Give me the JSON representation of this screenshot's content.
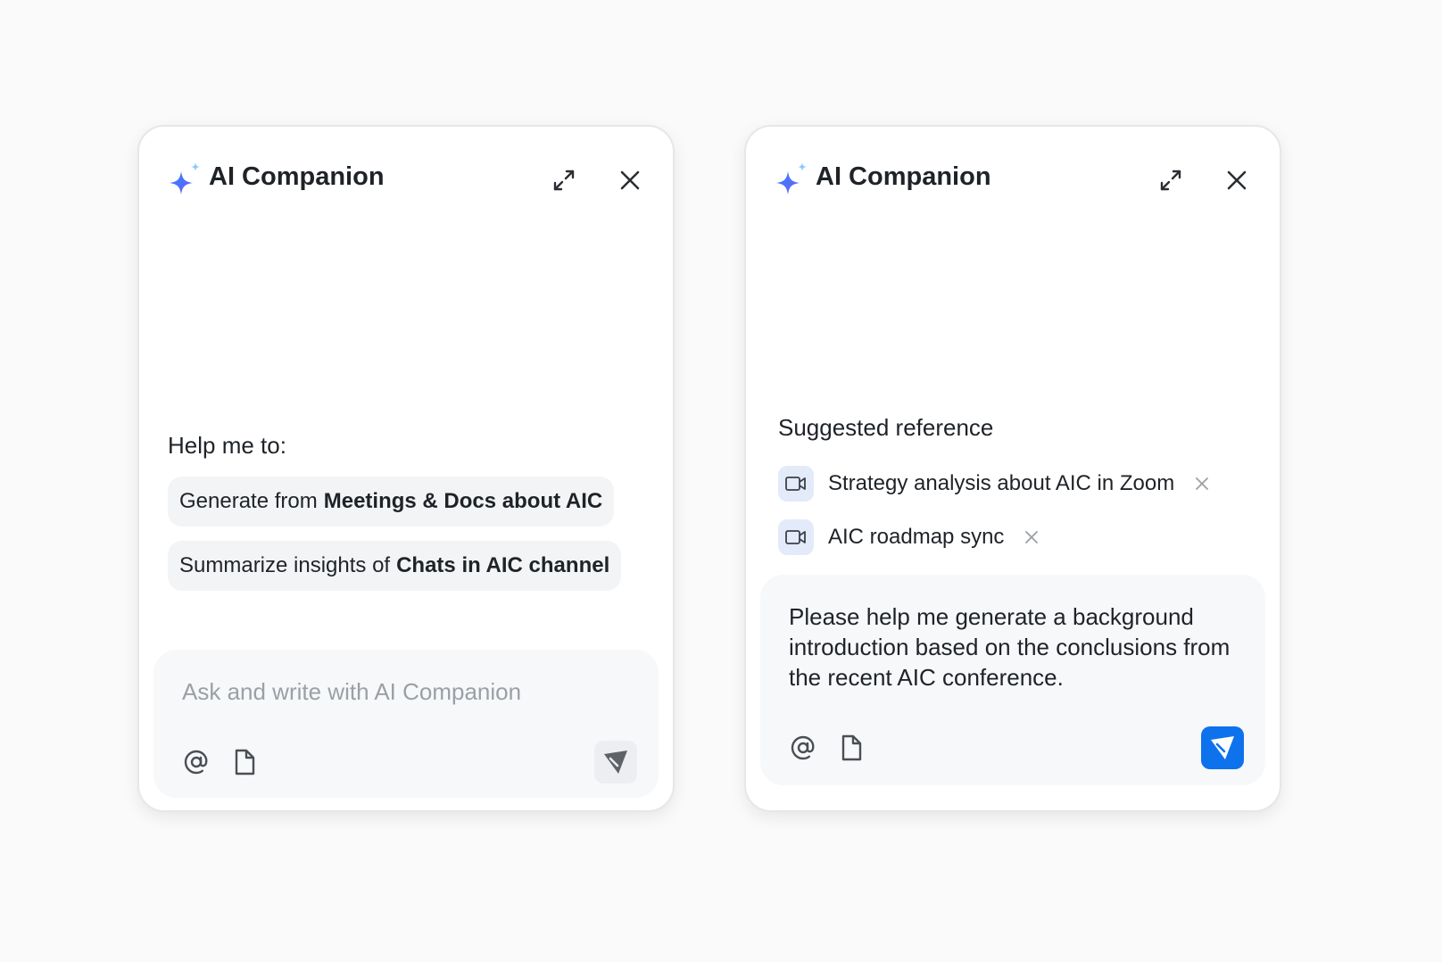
{
  "colors": {
    "background": "#fafafa",
    "panel": "#ffffff",
    "accent": "#0e72ed",
    "chip": "#f3f4f6",
    "ref_icon_bg": "#e3ebfa",
    "placeholder": "#9aa0a6"
  },
  "icons": {
    "logo": "sparkle-icon",
    "expand": "expand-icon",
    "close": "close-icon",
    "mention": "at-sign-icon",
    "attach": "file-icon",
    "send": "send-icon",
    "video": "video-camera-icon",
    "remove": "remove-icon"
  },
  "left_panel": {
    "title": "AI Companion",
    "help_label": "Help me to:",
    "suggestions": [
      {
        "prefix": "Generate from",
        "bold": "Meetings & Docs about AIC"
      },
      {
        "prefix": "Summarize insights of",
        "bold": "Chats in AIC channel"
      }
    ],
    "composer": {
      "placeholder": "Ask and write with AI Companion"
    }
  },
  "right_panel": {
    "title": "AI Companion",
    "suggested_label": "Suggested reference",
    "references": [
      {
        "label": "Strategy analysis about AIC in Zoom"
      },
      {
        "label": "AIC roadmap sync"
      }
    ],
    "composer": {
      "text": "Please help me generate a background introduction based on the conclusions from the recent AIC conference."
    }
  }
}
